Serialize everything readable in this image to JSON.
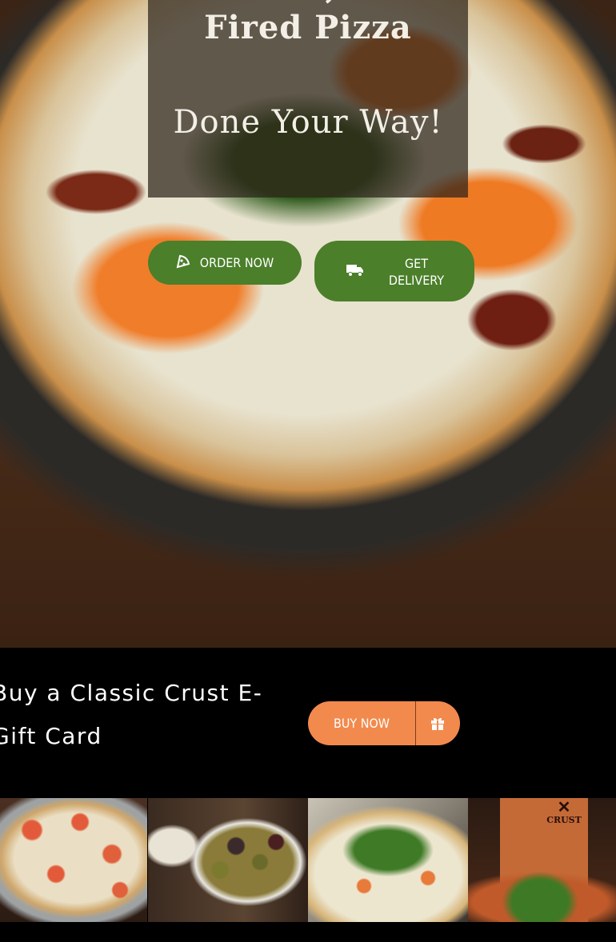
{
  "hero": {
    "title_line1": "Delicious, Wood-Fired Pizza",
    "title_line2": "Done Your Way!",
    "order_button": {
      "label": "ORDER NOW",
      "icon": "pizza-slice-icon"
    },
    "delivery_button": {
      "label": "GET DELIVERY",
      "icon": "truck-icon"
    }
  },
  "gift": {
    "text": "Buy a Classic Crust E-Gift Card",
    "button_label": "BUY NOW",
    "button_icon": "gift-icon"
  },
  "gallery": {
    "logo_text": "CRUST"
  },
  "colors": {
    "green_button": "#4b7f2a",
    "orange_button": "#f28a4d",
    "strip_background": "#000000"
  }
}
